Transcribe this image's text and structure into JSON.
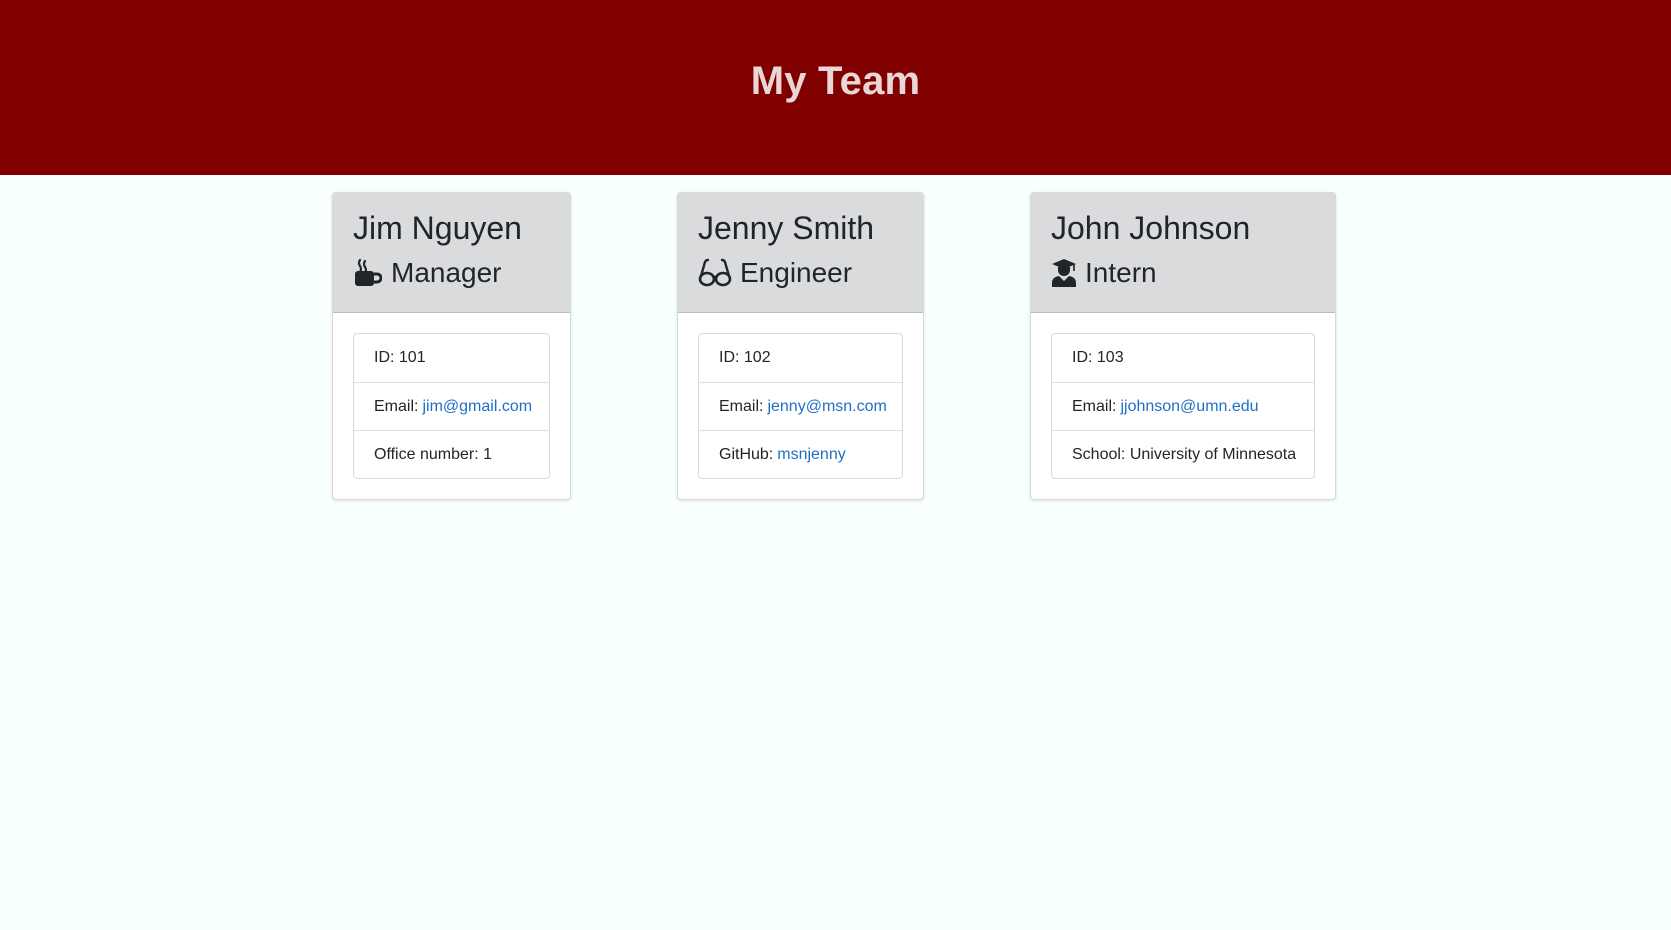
{
  "header": {
    "title": "My Team"
  },
  "employees": [
    {
      "name": "Jim Nguyen",
      "role": "Manager",
      "role_icon": "mug-icon",
      "id_label": "ID:",
      "id_value": "101",
      "email_label": "Email:",
      "email": "jim@gmail.com",
      "extra_label": "Office number:",
      "extra_value": "1"
    },
    {
      "name": "Jenny Smith",
      "role": "Engineer",
      "role_icon": "glasses-icon",
      "id_label": "ID:",
      "id_value": "102",
      "email_label": "Email:",
      "email": "jenny@msn.com",
      "extra_label": "GitHub:",
      "extra_value": "msnjenny"
    },
    {
      "name": "John Johnson",
      "role": "Intern",
      "role_icon": "graduate-icon",
      "id_label": "ID:",
      "id_value": "103",
      "email_label": "Email:",
      "email": "jjohnson@umn.edu",
      "extra_label": "School:",
      "extra_value": "University of Minnesota"
    }
  ],
  "colors": {
    "header_bg": "#800000",
    "header_text": "#e9d6d6",
    "card_header_bg": "#dadbdd",
    "link": "#1f6fc7",
    "page_bg": "#f8ffff"
  }
}
